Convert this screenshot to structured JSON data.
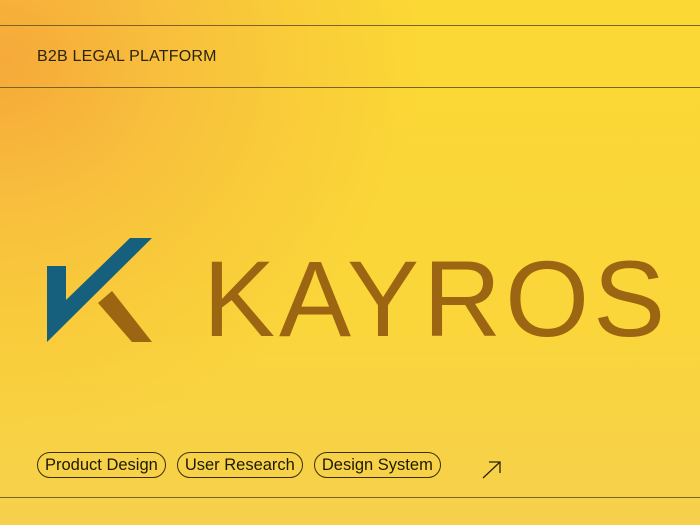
{
  "header": {
    "eyebrow": "B2B LEGAL PLATFORM"
  },
  "brand": {
    "name": "KAYROS",
    "colors": {
      "mark_blue": "#17607d",
      "brown": "#9b6511",
      "background": "#fbd834"
    }
  },
  "tags": [
    "Product Design",
    "User Research",
    "Design System"
  ],
  "link": {
    "icon": "arrow-up-right-icon"
  }
}
